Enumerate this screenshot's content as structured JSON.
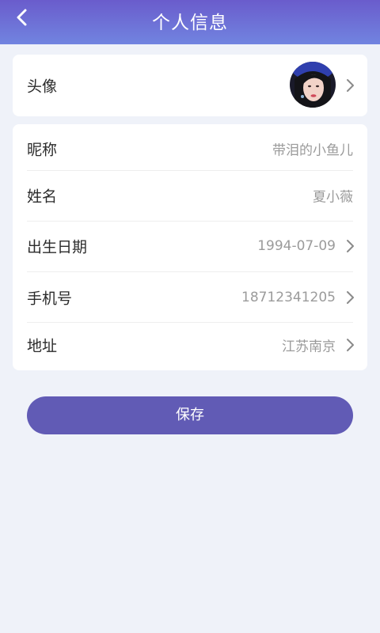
{
  "header": {
    "title": "个人信息",
    "back_icon": "chevron-left-icon"
  },
  "avatar_row": {
    "label": "头像"
  },
  "info_rows": [
    {
      "label": "昵称",
      "value": "带泪的小鱼儿"
    },
    {
      "label": "姓名",
      "value": "夏小薇"
    },
    {
      "label": "出生日期",
      "value": "1994-07-09"
    },
    {
      "label": "手机号",
      "value": "18712341205"
    },
    {
      "label": "地址",
      "value": "江苏南京"
    }
  ],
  "save_label": "保存",
  "colors": {
    "header_top": "#6a5ccc",
    "header_bottom": "#7184e0",
    "button": "#615bb5",
    "background": "#eff2f9"
  }
}
